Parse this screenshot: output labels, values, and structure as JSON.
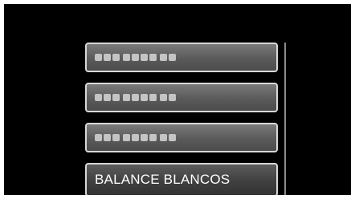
{
  "menu": {
    "items": [
      {
        "label": "",
        "state": "blurred"
      },
      {
        "label": "",
        "state": "blurred"
      },
      {
        "label": "",
        "state": "blurred"
      },
      {
        "label": "BALANCE BLANCOS",
        "state": "selected"
      }
    ]
  },
  "colors": {
    "background": "#000000",
    "item_border": "#d8d8d8",
    "item_fill": "#5a5a5a",
    "text": "#ffffff"
  }
}
